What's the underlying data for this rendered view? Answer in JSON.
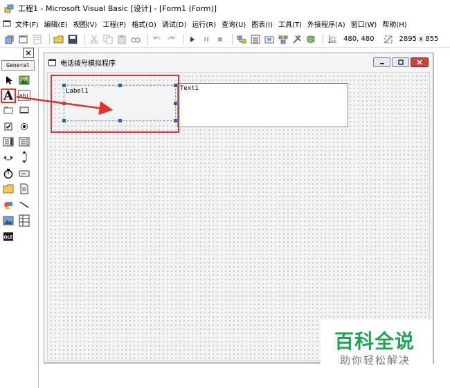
{
  "window": {
    "title": "工程1 - Microsoft Visual Basic [设计] - [Form1 (Form)]"
  },
  "menu": {
    "items": [
      {
        "label": "文件(F)"
      },
      {
        "label": "编辑(E)"
      },
      {
        "label": "视图(V)"
      },
      {
        "label": "工程(P)"
      },
      {
        "label": "格式(O)"
      },
      {
        "label": "调试(D)"
      },
      {
        "label": "运行(R)"
      },
      {
        "label": "查询(U)"
      },
      {
        "label": "图表(I)"
      },
      {
        "label": "工具(T)"
      },
      {
        "label": "外接程序(A)"
      },
      {
        "label": "窗口(W)"
      },
      {
        "label": "帮助(H)"
      }
    ]
  },
  "toolbar": {
    "position": "480, 480",
    "size": "2895 x 855"
  },
  "toolbox": {
    "tab_label": "General",
    "label_tool_glyph": "A",
    "textbox_tool_glyph": "ab|"
  },
  "form": {
    "title": "电话拨号模拟程序",
    "label_caption": "Label1",
    "textbox_text": "Text1"
  },
  "watermark": {
    "title": "百科全说",
    "subtitle": "助你轻松解决"
  },
  "colors": {
    "highlight": "#e3312c",
    "handle": "#1e64c8",
    "watermark_green": "#1fa455"
  }
}
